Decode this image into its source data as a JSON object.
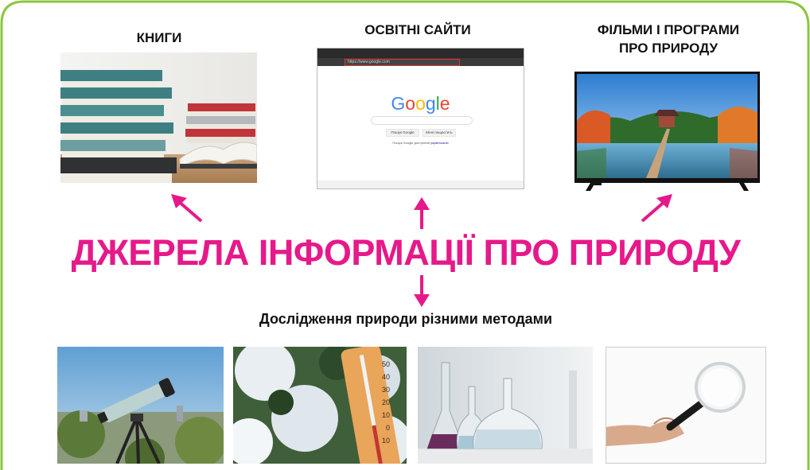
{
  "colors": {
    "accent": "#e6198a",
    "border": "#8cc63f"
  },
  "top_sources": [
    {
      "label": "КНИГИ",
      "icon": "books-photo"
    },
    {
      "label": "ОСВІТНІ САЙТИ",
      "icon": "browser-screenshot"
    },
    {
      "label_line1": "ФІЛЬМИ І ПРОГРАМИ",
      "label_line2": "ПРО ПРИРОДУ",
      "icon": "tv-photo"
    }
  ],
  "browser": {
    "logo": "Google",
    "search_button": "Пошук Google",
    "lucky_button": "Мені пощастить",
    "language_line": "Пошук Google доступний",
    "language_link": "українською",
    "url": "https://www.google.com"
  },
  "main_title": "ДЖЕРЕЛА ІНФОРМАЦІЇ ПРО ПРИРОДУ",
  "subtitle": "Дослідження природи різними методами",
  "thermometer": {
    "scale": [
      "50",
      "40",
      "30",
      "20",
      "10",
      "0",
      "10"
    ]
  },
  "methods": [
    {
      "icon": "telescope-photo"
    },
    {
      "icon": "thermometer-photo"
    },
    {
      "icon": "lab-flasks-photo"
    },
    {
      "icon": "magnifier-photo"
    }
  ]
}
